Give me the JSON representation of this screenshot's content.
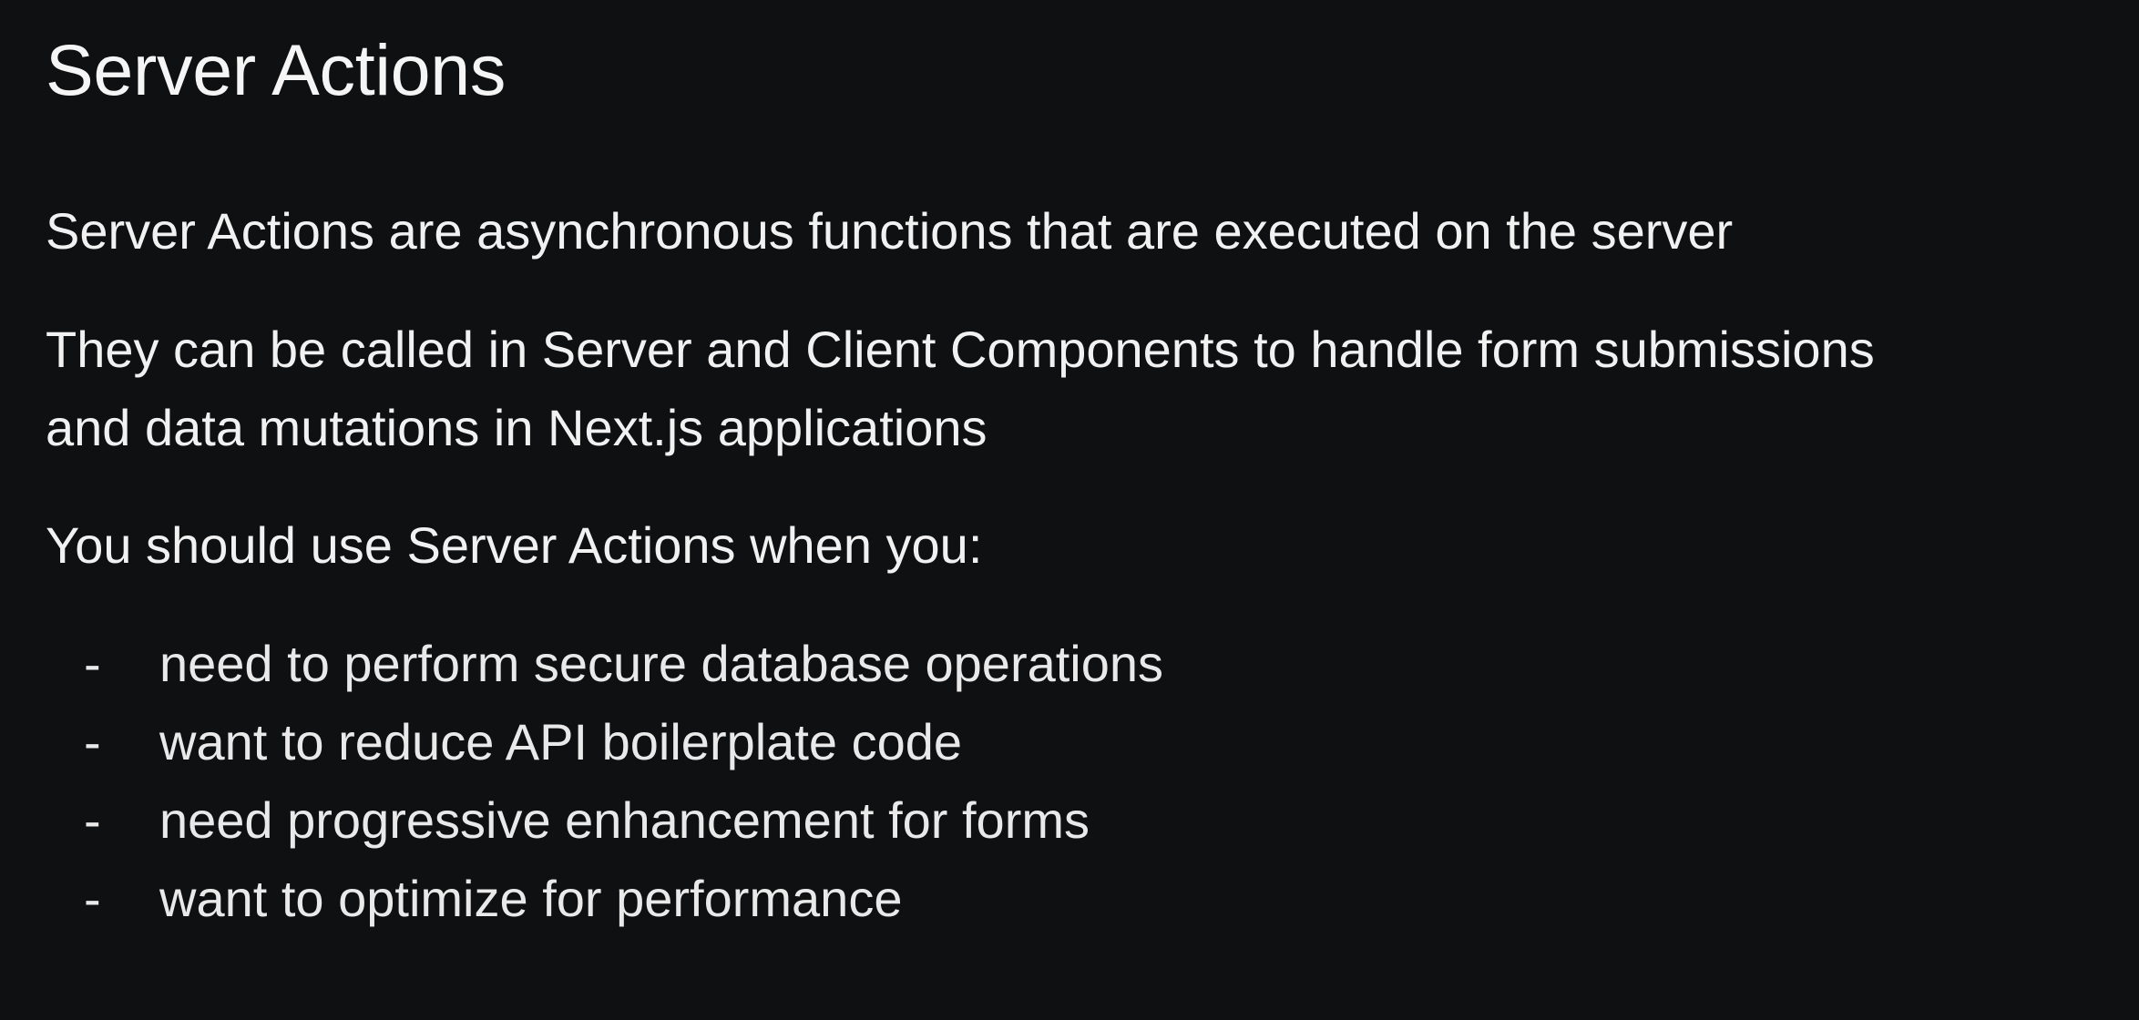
{
  "slide": {
    "title": "Server Actions",
    "paragraphs": [
      "Server Actions are asynchronous functions that are executed on the server",
      "They can be called in Server and Client Components to handle form submissions",
      "and data mutations in Next.js applications",
      "You should use Server Actions when you:"
    ],
    "bullets": [
      {
        "dash": "-",
        "text": "need to perform secure database operations"
      },
      {
        "dash": "-",
        "text": "want to reduce API boilerplate code"
      },
      {
        "dash": "-",
        "text": "need progressive enhancement for forms"
      },
      {
        "dash": "-",
        "text": "want to optimize for performance"
      }
    ]
  },
  "colors": {
    "background": "#0f1011",
    "text": "#f1f1f1"
  }
}
